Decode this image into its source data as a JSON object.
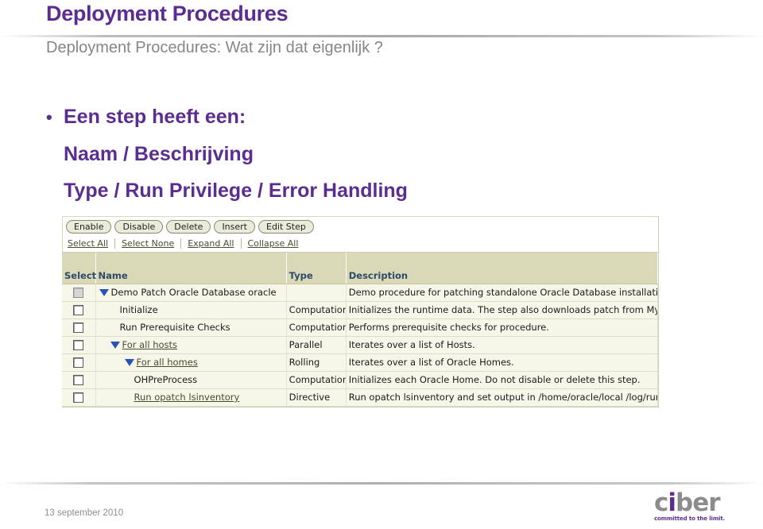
{
  "slide": {
    "title": "Deployment Procedures",
    "subtitle": "Deployment Procedures: Wat zijn dat eigenlijk ?",
    "bullets": [
      {
        "marker": "•",
        "text": "Een step heeft een:"
      },
      {
        "marker": "",
        "text": "Naam / Beschrijving"
      },
      {
        "marker": "",
        "text": "Type / Run Privilege / Error Handling"
      }
    ]
  },
  "oem": {
    "buttons": [
      "Enable",
      "Disable",
      "Delete",
      "Insert",
      "Edit Step"
    ],
    "links": [
      "Select All",
      "Select None",
      "Expand All",
      "Collapse All"
    ],
    "columns": [
      "Select",
      "Name",
      "Type",
      "Description"
    ],
    "rows": [
      {
        "checkbox_state": "disabled",
        "expander": "triangle-down",
        "indent": 0,
        "name": "Demo Patch Oracle Database oracle",
        "name_is_link": false,
        "type": "",
        "description": "Demo procedure for patching standalone Oracle Database installations with one-off patches, and patchsets as user oracle"
      },
      {
        "checkbox_state": "enabled",
        "expander": "",
        "indent": 1,
        "name": "Initialize",
        "name_is_link": false,
        "type": "Computational",
        "description": "Initializes the runtime data. The step also downloads patch from My Oracle Support and library components, for all patches selected to run from My Oracle Support. Do not disable this step."
      },
      {
        "checkbox_state": "enabled",
        "expander": "",
        "indent": 1,
        "name": "Run Prerequisite Checks",
        "name_is_link": false,
        "type": "Computational",
        "description": "Performs prerequisite checks for procedure."
      },
      {
        "checkbox_state": "enabled",
        "expander": "triangle-down",
        "indent": 2,
        "name": "For all hosts",
        "name_is_link": true,
        "type": "Parallel",
        "description": "Iterates over a list of Hosts."
      },
      {
        "checkbox_state": "enabled",
        "expander": "triangle-down",
        "indent": 3,
        "name": "For all homes",
        "name_is_link": true,
        "type": "Rolling",
        "description": "Iterates over a list of Oracle Homes."
      },
      {
        "checkbox_state": "enabled",
        "expander": "",
        "indent": 4,
        "name": "OHPreProcess",
        "name_is_link": false,
        "type": "Computational",
        "description": "Initializes each Oracle Home. Do not disable or delete this step."
      },
      {
        "checkbox_state": "enabled",
        "expander": "",
        "indent": 4,
        "name": "Run opatch lsinventory",
        "name_is_link": true,
        "type": "Directive",
        "description": "Run opatch lsinventory and set output in /home/oracle/local /log/run_opatch_lsinventory_<SIDs>_<YYYYMMDD_HH24MISS>.out"
      }
    ]
  },
  "footer": {
    "date": "13 september 2010",
    "logo": {
      "part1": "c",
      "part2": "i",
      "part3": "ber",
      "tagline": "committed to the limit."
    }
  },
  "colors": {
    "brand_purple": "#5c2d91",
    "subtitle_gray": "#868686",
    "table_header": "#d9d9b8",
    "table_header_text": "#2e4a6b",
    "row_bg": "#f7f7e9",
    "link_olive": "#4b4b2e",
    "triangle_blue": "#2a53b8"
  }
}
